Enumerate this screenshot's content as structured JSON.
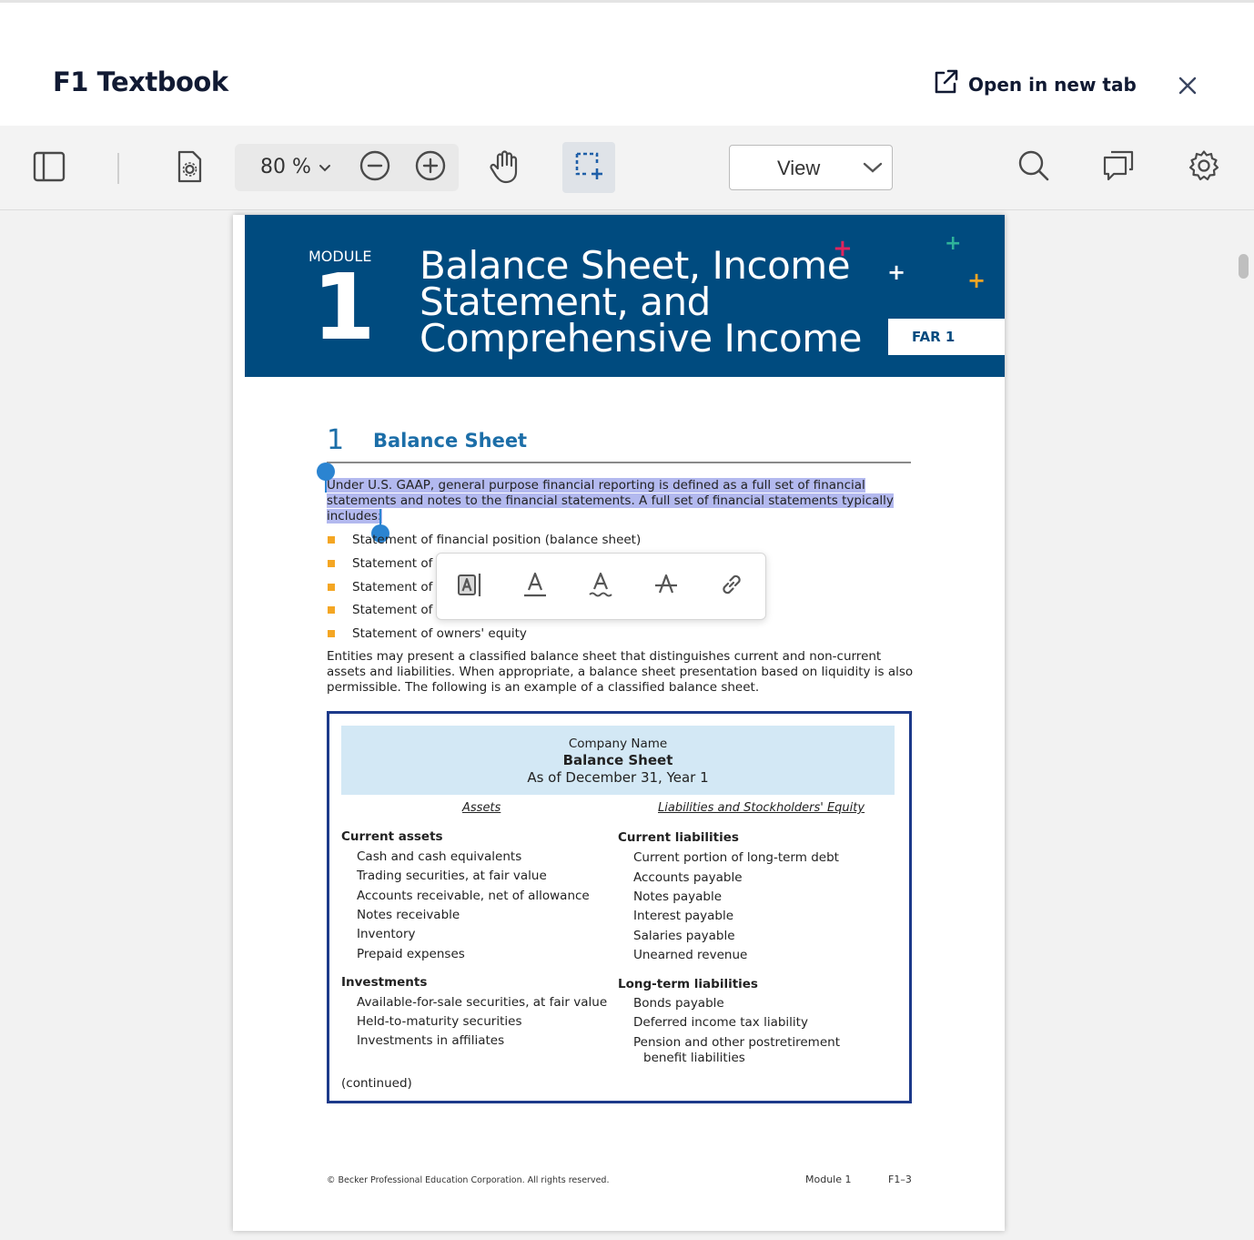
{
  "header": {
    "title": "F1 Textbook",
    "open_new_tab": "Open in new tab"
  },
  "toolbar": {
    "zoom": "80 %",
    "view_label": "View"
  },
  "page": {
    "banner": {
      "module_label": "MODULE",
      "module_number": "1",
      "title_line1": "Balance Sheet, Income",
      "title_line2": "Statement, and",
      "title_line3": "Comprehensive Income",
      "tab_label": "FAR 1"
    },
    "section": {
      "number": "1",
      "title": "Balance Sheet"
    },
    "selected_text": {
      "line1": "Under U.S. GAAP, general purpose financial reporting is defined as a full set of financial",
      "line2": "statements and notes to the financial statements. A full set of financial statements typically",
      "line3": "includes:"
    },
    "bullets": [
      "Statement of financial position (balance sheet)",
      "Statement of",
      "Statement of",
      "Statement of",
      "Statement of owners' equity"
    ],
    "paragraph": {
      "line1": "Entities may present a classified balance sheet that distinguishes current and non-current",
      "line2": "assets and liabilities. When appropriate, a balance sheet presentation based on liquidity is also",
      "line3": "permissible. The following is an example of a classified balance sheet."
    },
    "balance_sheet": {
      "company": "Company Name",
      "title": "Balance Sheet",
      "date": "As of December 31, Year 1",
      "assets_heading": "Assets",
      "liabilities_heading": "Liabilities and Stockholders' Equity",
      "current_assets": "Current assets",
      "current_assets_items": [
        "Cash and cash equivalents",
        "Trading securities, at fair value",
        "Accounts receivable, net of allowance",
        "Notes receivable",
        "Inventory",
        "Prepaid expenses"
      ],
      "investments": "Investments",
      "investments_items": [
        "Available-for-sale securities, at fair value",
        "Held-to-maturity securities",
        "Investments in affiliates"
      ],
      "current_liabilities": "Current liabilities",
      "current_liabilities_items": [
        "Current portion of long-term debt",
        "Accounts payable",
        "Notes payable",
        "Interest payable",
        "Salaries payable",
        "Unearned revenue"
      ],
      "long_term_liabilities": "Long-term liabilities",
      "long_term_items": [
        "Bonds payable",
        "Deferred income tax liability",
        "Pension and other postretirement"
      ],
      "long_term_item_cont": "benefit liabilities",
      "continued": "(continued)"
    },
    "footer": {
      "copyright": "© Becker Professional Education Corporation. All rights reserved.",
      "module": "Module 1",
      "page": "F1–3"
    }
  },
  "colors": {
    "banner": "#004b7f",
    "section_blue": "#1c6ea8",
    "highlight": "#b3b9ef",
    "bullet": "#f4a623",
    "box_border": "#1d3a8a",
    "box_header": "#d3e8f5"
  },
  "icons": [
    "sidebar-toggle-icon",
    "page-settings-icon",
    "zoom-out-icon",
    "zoom-in-icon",
    "pan-hand-icon",
    "marquee-select-icon",
    "search-icon",
    "comments-icon",
    "settings-icon",
    "external-link-icon",
    "close-icon",
    "highlight-icon",
    "underline-icon",
    "squiggly-icon",
    "strikethrough-icon",
    "link-icon"
  ]
}
